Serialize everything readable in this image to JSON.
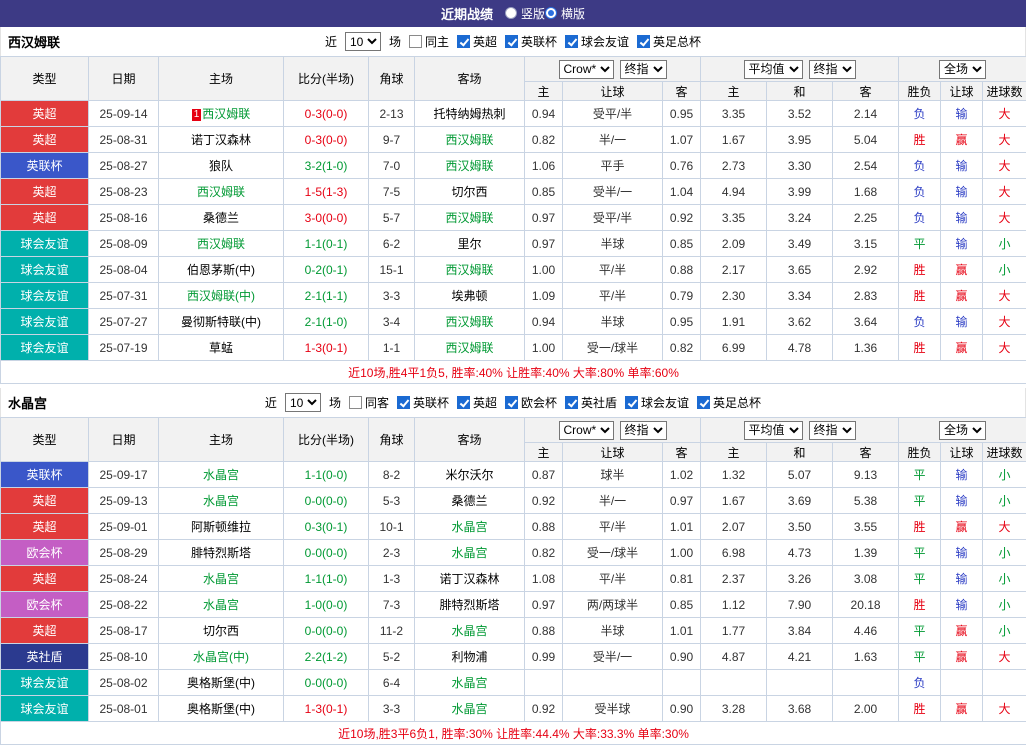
{
  "topbar": {
    "title": "近期战绩",
    "radios": [
      {
        "label": "竖版",
        "selected": false
      },
      {
        "label": "横版",
        "selected": true
      }
    ]
  },
  "labels": {
    "near": "近",
    "games": "场"
  },
  "colors": {
    "topbar_bg": "#3d3a85",
    "win_red": "#e60012",
    "draw_green": "#009933",
    "loss_blue": "#2b3cc4",
    "tracked_team_green": "#009933",
    "league_badges": {
      "英超": "#e23b3b",
      "英联杯": "#3a57c9",
      "球会友谊": "#00b0ac",
      "欧会杯": "#c45ec4",
      "英社盾": "#2b3a8f",
      "英足总杯": "#e23b3b"
    }
  },
  "table_header": {
    "fixed_cols": [
      "类型",
      "日期",
      "主场",
      "比分(半场)",
      "角球",
      "客场"
    ],
    "group1": {
      "provider": "Crow*",
      "final": "终指",
      "sub": [
        "主",
        "让球",
        "客"
      ]
    },
    "group2": {
      "provider": "平均值",
      "final": "终指",
      "sub": [
        "主",
        "和",
        "客"
      ]
    },
    "group3": {
      "provider": "全场",
      "sub": [
        "胜负",
        "让球",
        "进球数"
      ]
    }
  },
  "sections": [
    {
      "team": "西汉姆联",
      "near_value": "10",
      "same_label": "同主",
      "same_checked": false,
      "league_filters": [
        "英超",
        "英联杯",
        "球会友谊",
        "英足总杯"
      ],
      "summary": "近10场,胜4平1负5, 胜率:40% 让胜率:40% 大率:80% 单率:60%",
      "rows": [
        {
          "league": "英超",
          "date": "25-09-14",
          "home": "西汉姆联",
          "home_tracked": true,
          "home_prefix": "1",
          "score": "0-3(0-0)",
          "score_color": "red",
          "corner": "2-13",
          "away": "托特纳姆热刺",
          "away_tracked": false,
          "asia_home": "0.94",
          "handicap": "受平/半",
          "asia_away": "0.95",
          "euro_home": "3.35",
          "euro_draw": "3.52",
          "euro_away": "2.14",
          "result": "负",
          "result_color": "blue",
          "let_result": "输",
          "let_color": "blue",
          "goals": "大",
          "goals_color": "red"
        },
        {
          "league": "英超",
          "date": "25-08-31",
          "home": "诺丁汉森林",
          "home_tracked": false,
          "score": "0-3(0-0)",
          "score_color": "red",
          "corner": "9-7",
          "away": "西汉姆联",
          "away_tracked": true,
          "asia_home": "0.82",
          "handicap": "半/一",
          "asia_away": "1.07",
          "euro_home": "1.67",
          "euro_draw": "3.95",
          "euro_away": "5.04",
          "result": "胜",
          "result_color": "red",
          "let_result": "赢",
          "let_color": "red",
          "goals": "大",
          "goals_color": "red"
        },
        {
          "league": "英联杯",
          "date": "25-08-27",
          "home": "狼队",
          "home_tracked": false,
          "score": "3-2(1-0)",
          "score_color": "green",
          "corner": "7-0",
          "away": "西汉姆联",
          "away_tracked": true,
          "asia_home": "1.06",
          "handicap": "平手",
          "asia_away": "0.76",
          "euro_home": "2.73",
          "euro_draw": "3.30",
          "euro_away": "2.54",
          "result": "负",
          "result_color": "blue",
          "let_result": "输",
          "let_color": "blue",
          "goals": "大",
          "goals_color": "red"
        },
        {
          "league": "英超",
          "date": "25-08-23",
          "home": "西汉姆联",
          "home_tracked": true,
          "score": "1-5(1-3)",
          "score_color": "red",
          "corner": "7-5",
          "away": "切尔西",
          "away_tracked": false,
          "asia_home": "0.85",
          "handicap": "受半/一",
          "asia_away": "1.04",
          "euro_home": "4.94",
          "euro_draw": "3.99",
          "euro_away": "1.68",
          "result": "负",
          "result_color": "blue",
          "let_result": "输",
          "let_color": "blue",
          "goals": "大",
          "goals_color": "red"
        },
        {
          "league": "英超",
          "date": "25-08-16",
          "home": "桑德兰",
          "home_tracked": false,
          "score": "3-0(0-0)",
          "score_color": "red",
          "corner": "5-7",
          "away": "西汉姆联",
          "away_tracked": true,
          "asia_home": "0.97",
          "handicap": "受平/半",
          "asia_away": "0.92",
          "euro_home": "3.35",
          "euro_draw": "3.24",
          "euro_away": "2.25",
          "result": "负",
          "result_color": "blue",
          "let_result": "输",
          "let_color": "blue",
          "goals": "大",
          "goals_color": "red"
        },
        {
          "league": "球会友谊",
          "date": "25-08-09",
          "home": "西汉姆联",
          "home_tracked": true,
          "score": "1-1(0-1)",
          "score_color": "green",
          "corner": "6-2",
          "away": "里尔",
          "away_tracked": false,
          "asia_home": "0.97",
          "handicap": "半球",
          "asia_away": "0.85",
          "euro_home": "2.09",
          "euro_draw": "3.49",
          "euro_away": "3.15",
          "result": "平",
          "result_color": "green",
          "let_result": "输",
          "let_color": "blue",
          "goals": "小",
          "goals_color": "green"
        },
        {
          "league": "球会友谊",
          "date": "25-08-04",
          "home": "伯恩茅斯(中)",
          "home_tracked": false,
          "score": "0-2(0-1)",
          "score_color": "green",
          "corner": "15-1",
          "away": "西汉姆联",
          "away_tracked": true,
          "asia_home": "1.00",
          "handicap": "平/半",
          "asia_away": "0.88",
          "euro_home": "2.17",
          "euro_draw": "3.65",
          "euro_away": "2.92",
          "result": "胜",
          "result_color": "red",
          "let_result": "赢",
          "let_color": "red",
          "goals": "小",
          "goals_color": "green"
        },
        {
          "league": "球会友谊",
          "date": "25-07-31",
          "home": "西汉姆联(中)",
          "home_tracked": true,
          "score": "2-1(1-1)",
          "score_color": "green",
          "corner": "3-3",
          "away": "埃弗顿",
          "away_tracked": false,
          "asia_home": "1.09",
          "handicap": "平/半",
          "asia_away": "0.79",
          "euro_home": "2.30",
          "euro_draw": "3.34",
          "euro_away": "2.83",
          "result": "胜",
          "result_color": "red",
          "let_result": "赢",
          "let_color": "red",
          "goals": "大",
          "goals_color": "red"
        },
        {
          "league": "球会友谊",
          "date": "25-07-27",
          "home": "曼彻斯特联(中)",
          "home_tracked": false,
          "score": "2-1(1-0)",
          "score_color": "green",
          "corner": "3-4",
          "away": "西汉姆联",
          "away_tracked": true,
          "asia_home": "0.94",
          "handicap": "半球",
          "asia_away": "0.95",
          "euro_home": "1.91",
          "euro_draw": "3.62",
          "euro_away": "3.64",
          "result": "负",
          "result_color": "blue",
          "let_result": "输",
          "let_color": "blue",
          "goals": "大",
          "goals_color": "red"
        },
        {
          "league": "球会友谊",
          "date": "25-07-19",
          "home": "草蜢",
          "home_tracked": false,
          "score": "1-3(0-1)",
          "score_color": "red",
          "corner": "1-1",
          "away": "西汉姆联",
          "away_tracked": true,
          "asia_home": "1.00",
          "handicap": "受一/球半",
          "asia_away": "0.82",
          "euro_home": "6.99",
          "euro_draw": "4.78",
          "euro_away": "1.36",
          "result": "胜",
          "result_color": "red",
          "let_result": "赢",
          "let_color": "red",
          "goals": "大",
          "goals_color": "red"
        }
      ]
    },
    {
      "team": "水晶宫",
      "near_value": "10",
      "same_label": "同客",
      "same_checked": false,
      "league_filters": [
        "英联杯",
        "英超",
        "欧会杯",
        "英社盾",
        "球会友谊",
        "英足总杯"
      ],
      "summary": "近10场,胜3平6负1, 胜率:30% 让胜率:44.4% 大率:33.3% 单率:30%",
      "rows": [
        {
          "league": "英联杯",
          "date": "25-09-17",
          "home": "水晶宫",
          "home_tracked": true,
          "score": "1-1(0-0)",
          "score_color": "green",
          "corner": "8-2",
          "away": "米尔沃尔",
          "away_tracked": false,
          "asia_home": "0.87",
          "handicap": "球半",
          "asia_away": "1.02",
          "euro_home": "1.32",
          "euro_draw": "5.07",
          "euro_away": "9.13",
          "result": "平",
          "result_color": "green",
          "let_result": "输",
          "let_color": "blue",
          "goals": "小",
          "goals_color": "green"
        },
        {
          "league": "英超",
          "date": "25-09-13",
          "home": "水晶宫",
          "home_tracked": true,
          "score": "0-0(0-0)",
          "score_color": "green",
          "corner": "5-3",
          "away": "桑德兰",
          "away_tracked": false,
          "asia_home": "0.92",
          "handicap": "半/一",
          "asia_away": "0.97",
          "euro_home": "1.67",
          "euro_draw": "3.69",
          "euro_away": "5.38",
          "result": "平",
          "result_color": "green",
          "let_result": "输",
          "let_color": "blue",
          "goals": "小",
          "goals_color": "green"
        },
        {
          "league": "英超",
          "date": "25-09-01",
          "home": "阿斯顿维拉",
          "home_tracked": false,
          "score": "0-3(0-1)",
          "score_color": "green",
          "corner": "10-1",
          "away": "水晶宫",
          "away_tracked": true,
          "asia_home": "0.88",
          "handicap": "平/半",
          "asia_away": "1.01",
          "euro_home": "2.07",
          "euro_draw": "3.50",
          "euro_away": "3.55",
          "result": "胜",
          "result_color": "red",
          "let_result": "赢",
          "let_color": "red",
          "goals": "大",
          "goals_color": "red"
        },
        {
          "league": "欧会杯",
          "date": "25-08-29",
          "home": "腓特烈斯塔",
          "home_tracked": false,
          "score": "0-0(0-0)",
          "score_color": "green",
          "corner": "2-3",
          "away": "水晶宫",
          "away_tracked": true,
          "asia_home": "0.82",
          "handicap": "受一/球半",
          "asia_away": "1.00",
          "euro_home": "6.98",
          "euro_draw": "4.73",
          "euro_away": "1.39",
          "result": "平",
          "result_color": "green",
          "let_result": "输",
          "let_color": "blue",
          "goals": "小",
          "goals_color": "green"
        },
        {
          "league": "英超",
          "date": "25-08-24",
          "home": "水晶宫",
          "home_tracked": true,
          "score": "1-1(1-0)",
          "score_color": "green",
          "corner": "1-3",
          "away": "诺丁汉森林",
          "away_tracked": false,
          "asia_home": "1.08",
          "handicap": "平/半",
          "asia_away": "0.81",
          "euro_home": "2.37",
          "euro_draw": "3.26",
          "euro_away": "3.08",
          "result": "平",
          "result_color": "green",
          "let_result": "输",
          "let_color": "blue",
          "goals": "小",
          "goals_color": "green"
        },
        {
          "league": "欧会杯",
          "date": "25-08-22",
          "home": "水晶宫",
          "home_tracked": true,
          "score": "1-0(0-0)",
          "score_color": "green",
          "corner": "7-3",
          "away": "腓特烈斯塔",
          "away_tracked": false,
          "asia_home": "0.97",
          "handicap": "两/两球半",
          "asia_away": "0.85",
          "euro_home": "1.12",
          "euro_draw": "7.90",
          "euro_away": "20.18",
          "result": "胜",
          "result_color": "red",
          "let_result": "输",
          "let_color": "blue",
          "goals": "小",
          "goals_color": "green"
        },
        {
          "league": "英超",
          "date": "25-08-17",
          "home": "切尔西",
          "home_tracked": false,
          "score": "0-0(0-0)",
          "score_color": "green",
          "corner": "11-2",
          "away": "水晶宫",
          "away_tracked": true,
          "asia_home": "0.88",
          "handicap": "半球",
          "asia_away": "1.01",
          "euro_home": "1.77",
          "euro_draw": "3.84",
          "euro_away": "4.46",
          "result": "平",
          "result_color": "green",
          "let_result": "赢",
          "let_color": "red",
          "goals": "小",
          "goals_color": "green"
        },
        {
          "league": "英社盾",
          "date": "25-08-10",
          "home": "水晶宫(中)",
          "home_tracked": true,
          "score": "2-2(1-2)",
          "score_color": "green",
          "corner": "5-2",
          "away": "利物浦",
          "away_tracked": false,
          "asia_home": "0.99",
          "handicap": "受半/一",
          "asia_away": "0.90",
          "euro_home": "4.87",
          "euro_draw": "4.21",
          "euro_away": "1.63",
          "result": "平",
          "result_color": "green",
          "let_result": "赢",
          "let_color": "red",
          "goals": "大",
          "goals_color": "red"
        },
        {
          "league": "球会友谊",
          "date": "25-08-02",
          "home": "奥格斯堡(中)",
          "home_tracked": false,
          "score": "0-0(0-0)",
          "score_color": "green",
          "corner": "6-4",
          "away": "水晶宫",
          "away_tracked": true,
          "asia_home": "",
          "handicap": "",
          "asia_away": "",
          "euro_home": "",
          "euro_draw": "",
          "euro_away": "",
          "result": "负",
          "result_color": "blue",
          "let_result": "",
          "let_color": "blue",
          "goals": "",
          "goals_color": "green"
        },
        {
          "league": "球会友谊",
          "date": "25-08-01",
          "home": "奥格斯堡(中)",
          "home_tracked": false,
          "score": "1-3(0-1)",
          "score_color": "red",
          "corner": "3-3",
          "away": "水晶宫",
          "away_tracked": true,
          "asia_home": "0.92",
          "handicap": "受半球",
          "asia_away": "0.90",
          "euro_home": "3.28",
          "euro_draw": "3.68",
          "euro_away": "2.00",
          "result": "胜",
          "result_color": "red",
          "let_result": "赢",
          "let_color": "red",
          "goals": "大",
          "goals_color": "red"
        }
      ]
    }
  ]
}
